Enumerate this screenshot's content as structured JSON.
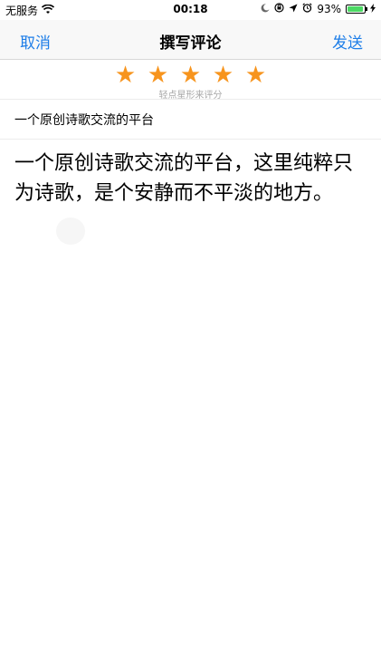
{
  "status_bar": {
    "carrier": "无服务",
    "time": "00:18",
    "battery_percent": "93%",
    "battery_level": 0.93,
    "icons": [
      "wifi-icon",
      "moon-icon",
      "orientation-lock-icon",
      "location-arrow-icon",
      "alarm-icon",
      "battery-icon",
      "charging-bolt-icon"
    ]
  },
  "nav": {
    "cancel_label": "取消",
    "title": "撰写评论",
    "send_label": "发送"
  },
  "rating": {
    "value": 5,
    "max": 5,
    "star_glyph": "★",
    "hint": "轻点星形来评分",
    "color": "#f7941d"
  },
  "review": {
    "title": "一个原创诗歌交流的平台",
    "body": "一个原创诗歌交流的平台，这里纯粹只为诗歌，是个安静而不平淡的地方。"
  },
  "colors": {
    "accent": "#1e7ee8",
    "star": "#f7941d",
    "battery": "#4cd964"
  }
}
